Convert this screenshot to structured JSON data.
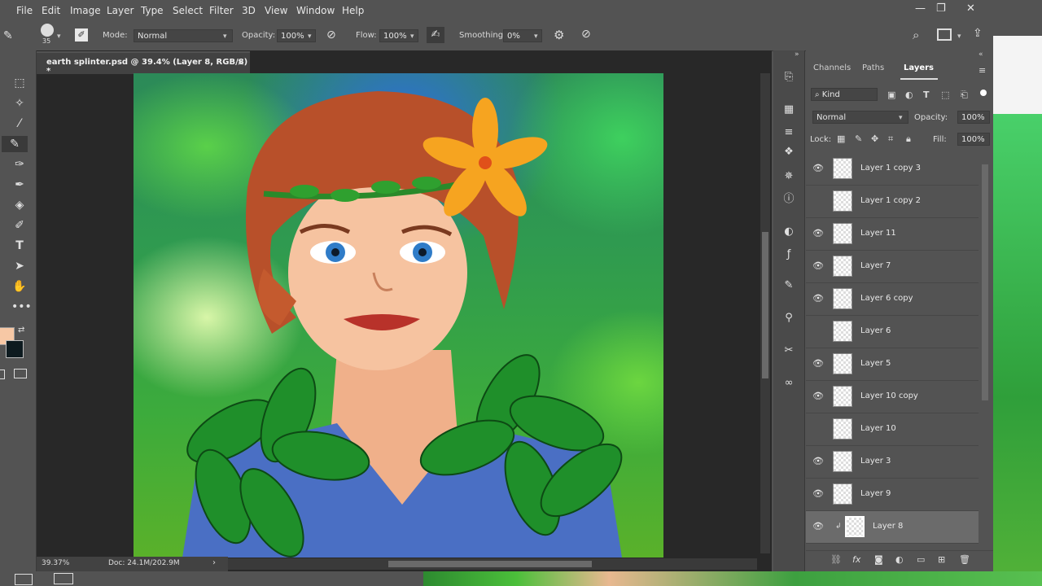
{
  "menu": [
    "File",
    "Edit",
    "Image",
    "Layer",
    "Type",
    "Select",
    "Filter",
    "3D",
    "View",
    "Window",
    "Help"
  ],
  "window_controls": {
    "minimize": "—",
    "restore": "❐",
    "close": "✕"
  },
  "options": {
    "brush_size": "35",
    "mode_label": "Mode:",
    "mode_value": "Normal",
    "opacity_label": "Opacity:",
    "opacity_value": "100%",
    "flow_label": "Flow:",
    "flow_value": "100%",
    "smoothing_label": "Smoothing:",
    "smoothing_value": "0%"
  },
  "document": {
    "tab_title": "earth splinter.psd @ 39.4% (Layer 8, RGB/8) *",
    "tab_close": "×",
    "zoom": "39.37%",
    "doc_size": "Doc: 24.1M/202.9M"
  },
  "panel": {
    "tabs": [
      "Channels",
      "Paths",
      "Layers"
    ],
    "filter_kind": "Kind",
    "blend_mode": "Normal",
    "opacity_label": "Opacity:",
    "opacity_value": "100%",
    "lock_label": "Lock:",
    "fill_label": "Fill:",
    "fill_value": "100%",
    "layers": [
      {
        "name": "Layer 1 copy 3",
        "visible": true
      },
      {
        "name": "Layer 1 copy 2",
        "visible": false
      },
      {
        "name": "Layer 11",
        "visible": true
      },
      {
        "name": "Layer 7",
        "visible": true
      },
      {
        "name": "Layer 6 copy",
        "visible": true
      },
      {
        "name": "Layer 6",
        "visible": false
      },
      {
        "name": "Layer 5",
        "visible": true
      },
      {
        "name": "Layer 10 copy",
        "visible": true
      },
      {
        "name": "Layer 10",
        "visible": false
      },
      {
        "name": "Layer 3",
        "visible": true
      },
      {
        "name": "Layer 9",
        "visible": true
      },
      {
        "name": "Layer 8",
        "visible": true,
        "selected": true
      }
    ]
  },
  "colors": {
    "foreground": "#f7c8a5",
    "background": "#0d1a1f"
  }
}
